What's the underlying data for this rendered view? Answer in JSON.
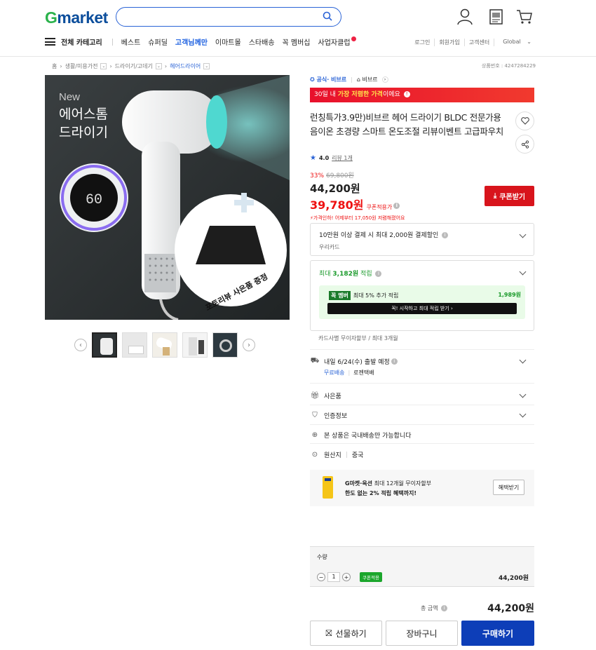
{
  "header": {
    "logo_g": "G",
    "logo_rest": "market",
    "search_placeholder": "",
    "nav": {
      "category": "전체 카테고리",
      "items": [
        "베스트",
        "슈퍼딜",
        "고객님께만",
        "이마트몰",
        "스타배송",
        "꼭 멤버십",
        "사업자클럽"
      ]
    },
    "util": [
      "로그인",
      "회원가입",
      "고객센터",
      "Global"
    ]
  },
  "breadcrumb": [
    "홈",
    "생활/미용가전",
    "드라이기/고데기",
    "헤어드라이어"
  ],
  "product_no": "상품번호 : 4247284229",
  "image": {
    "new": "New",
    "line1": "에어스톰",
    "line2": "드라이기",
    "display": "60",
    "gift": "포토리뷰 사은품 증정"
  },
  "product": {
    "badge_official": "공식· 비브르",
    "badge_brand": "비브르",
    "promo_prefix": "30일 내 ",
    "promo_strong": "가장 저렴한 가격",
    "promo_suffix": "이에요",
    "title": "런칭특가3.9만)비브르 헤어 드라이기 BLDC 전문가용 음이온 초경량 스마트 온도조절 리뷰이벤트 고급파우치",
    "rating": "4.0",
    "reviews": "리뷰 1개",
    "discount": "33%",
    "original": "69,800원",
    "price": "44,200원",
    "coupon_price": "39,780원",
    "coupon_applied": "쿠폰적용가",
    "price_notice": "가격인하! 어제부터 17,050원 저렴해졌어요",
    "coupon_btn": "쿠폰받기"
  },
  "card_payment": {
    "title": "10만원 이상 결제 시 최대 2,000원 결제할인",
    "sub": "우리카드"
  },
  "points": {
    "label_prefix": "최대 ",
    "amount": "3,182원",
    "label_suffix": " 적립",
    "member_tag": "꼭 멤버",
    "member_text": "최대 5% 추가 적립",
    "member_amount": "1,989원",
    "member_cta": "꼭! 시작하고 최대 적립 받기"
  },
  "installment": "카드사별 무이자할부 / 최대 3개월",
  "shipping": {
    "title": "내일 6/24(수) 출발 예정",
    "free": "무료배송",
    "carrier": "로젠택배"
  },
  "rows": [
    "사은품",
    "인증정보",
    "본 상품은 국내배송만 가능합니다"
  ],
  "origin_label": "원산지",
  "origin_value": "중국",
  "card_promo": {
    "line1_strong": "G마켓·옥션",
    "line1": " 최대 12개월 무이자할부",
    "line2": "한도 없는 2% 적립 혜택까지!",
    "button": "혜택받기"
  },
  "quantity": {
    "label": "수량",
    "value": "1",
    "coupon_tag": "쿠폰적용",
    "price": "44,200원"
  },
  "total": {
    "label": "총 금액",
    "value": "44,200원"
  },
  "buttons": {
    "gift": "선물하기",
    "cart": "장바구니",
    "buy": "구매하기"
  }
}
